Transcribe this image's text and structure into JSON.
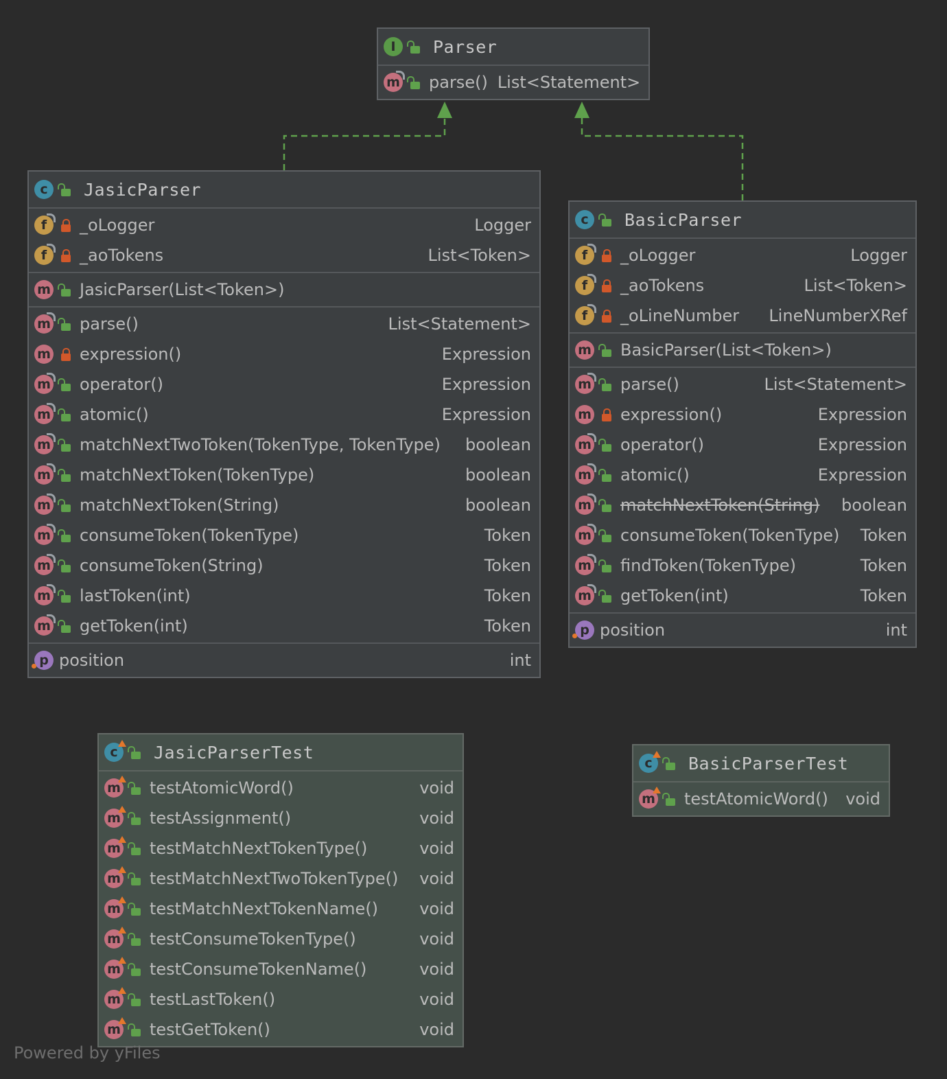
{
  "diagram": {
    "interface": {
      "name": "Parser",
      "methods": [
        {
          "name": "parse()",
          "type": "List<Statement>"
        }
      ]
    },
    "jasic": {
      "name": "JasicParser",
      "fields": [
        {
          "name": "_oLogger",
          "type": "Logger"
        },
        {
          "name": "_aoTokens",
          "type": "List<Token>"
        }
      ],
      "constructors": [
        {
          "name": "JasicParser(List<Token>)",
          "type": ""
        }
      ],
      "methods": [
        {
          "name": "parse()",
          "type": "List<Statement>"
        },
        {
          "name": "expression()",
          "type": "Expression"
        },
        {
          "name": "operator()",
          "type": "Expression"
        },
        {
          "name": "atomic()",
          "type": "Expression"
        },
        {
          "name": "matchNextTwoToken(TokenType, TokenType)",
          "type": "boolean"
        },
        {
          "name": "matchNextToken(TokenType)",
          "type": "boolean"
        },
        {
          "name": "matchNextToken(String)",
          "type": "boolean"
        },
        {
          "name": "consumeToken(TokenType)",
          "type": "Token"
        },
        {
          "name": "consumeToken(String)",
          "type": "Token"
        },
        {
          "name": "lastToken(int)",
          "type": "Token"
        },
        {
          "name": "getToken(int)",
          "type": "Token"
        }
      ],
      "properties": [
        {
          "name": "position",
          "type": "int"
        }
      ]
    },
    "basic": {
      "name": "BasicParser",
      "fields": [
        {
          "name": "_oLogger",
          "type": "Logger"
        },
        {
          "name": "_aoTokens",
          "type": "List<Token>"
        },
        {
          "name": "_oLineNumber",
          "type": "LineNumberXRef"
        }
      ],
      "constructors": [
        {
          "name": "BasicParser(List<Token>)",
          "type": ""
        }
      ],
      "methods": [
        {
          "name": "parse()",
          "type": "List<Statement>"
        },
        {
          "name": "expression()",
          "type": "Expression"
        },
        {
          "name": "operator()",
          "type": "Expression"
        },
        {
          "name": "atomic()",
          "type": "Expression"
        },
        {
          "name": "matchNextToken(String)",
          "type": "boolean"
        },
        {
          "name": "consumeToken(TokenType)",
          "type": "Token"
        },
        {
          "name": "findToken(TokenType)",
          "type": "Token"
        },
        {
          "name": "getToken(int)",
          "type": "Token"
        }
      ],
      "properties": [
        {
          "name": "position",
          "type": "int"
        }
      ]
    },
    "jasicTest": {
      "name": "JasicParserTest",
      "methods": [
        {
          "name": "testAtomicWord()",
          "type": "void"
        },
        {
          "name": "testAssignment()",
          "type": "void"
        },
        {
          "name": "testMatchNextTokenType()",
          "type": "void"
        },
        {
          "name": "testMatchNextTwoTokenType()",
          "type": "void"
        },
        {
          "name": "testMatchNextTokenName()",
          "type": "void"
        },
        {
          "name": "testConsumeTokenType()",
          "type": "void"
        },
        {
          "name": "testConsumeTokenName()",
          "type": "void"
        },
        {
          "name": "testLastToken()",
          "type": "void"
        },
        {
          "name": "testGetToken()",
          "type": "void"
        }
      ]
    },
    "basicTest": {
      "name": "BasicParserTest",
      "methods": [
        {
          "name": "testAtomicWord()",
          "type": "void"
        }
      ]
    }
  },
  "badges": {
    "class": "c",
    "interface": "I",
    "field": "f",
    "method": "m",
    "property": "p"
  },
  "footer": "Powered by yFiles"
}
